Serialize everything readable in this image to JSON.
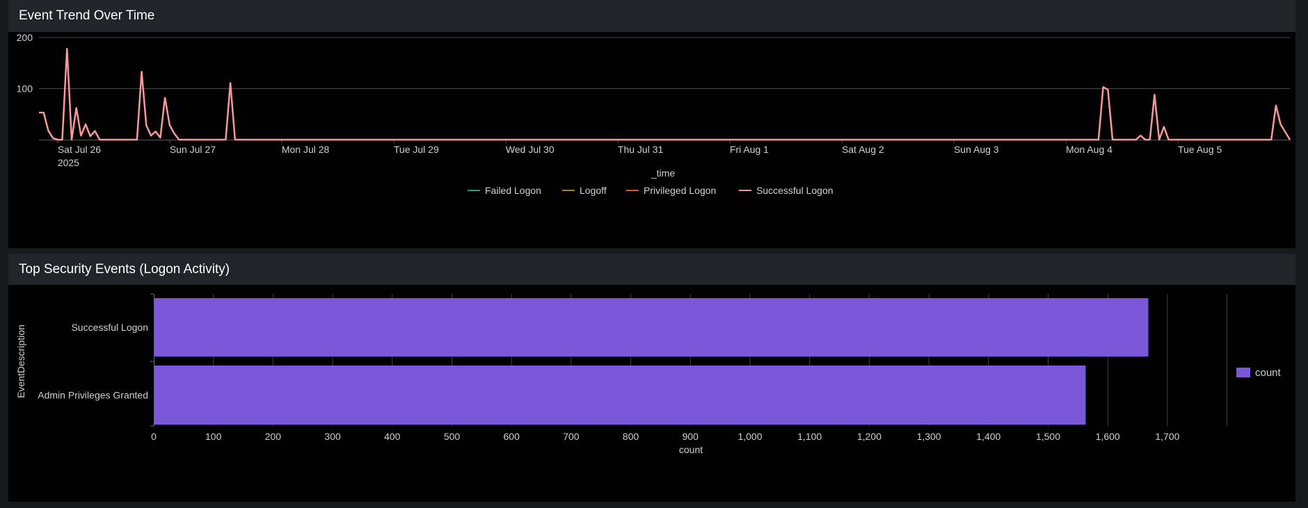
{
  "panels": [
    {
      "title": "Event Trend Over Time"
    },
    {
      "title": "Top Security Events (Logon Activity)"
    }
  ],
  "colors": {
    "panel_bg": "#000000",
    "header_bg": "#212529",
    "page_bg": "#171a1d",
    "failed_logon": "#1f9c93",
    "logoff": "#b87a1a",
    "privileged_logon": "#d8552a",
    "successful_logon": "#f79999",
    "bar": "#7b57d9"
  },
  "chart_data": [
    {
      "type": "line",
      "title": "Event Trend Over Time",
      "xlabel": "_time",
      "ylabel": "",
      "ylim": [
        0,
        200
      ],
      "y_ticks": [
        "100",
        "200"
      ],
      "x_ticks": [
        "Sat Jul 26",
        "Sun Jul 27",
        "Mon Jul 28",
        "Tue Jul 29",
        "Wed Jul 30",
        "Thu Jul 31",
        "Fri Aug 1",
        "Sat Aug 2",
        "Sun Aug 3",
        "Mon Aug 4",
        "Tue Aug 5"
      ],
      "x_tick_year": "2025",
      "grid": true,
      "legend": "bottom",
      "series": [
        {
          "name": "Failed Logon",
          "points": []
        },
        {
          "name": "Logoff",
          "points": []
        },
        {
          "name": "Privileged Logon",
          "points": []
        },
        {
          "name": "Successful Logon",
          "points": [
            [
              "2025-07-25 21:00",
              53
            ],
            [
              "2025-07-25 22:00",
              18
            ],
            [
              "2025-07-25 23:00",
              3
            ],
            [
              "2025-07-26 00:00",
              0
            ],
            [
              "2025-07-26 01:00",
              0
            ],
            [
              "2025-07-26 02:00",
              178
            ],
            [
              "2025-07-26 03:00",
              0
            ],
            [
              "2025-07-26 04:00",
              62
            ],
            [
              "2025-07-26 05:00",
              8
            ],
            [
              "2025-07-26 06:00",
              30
            ],
            [
              "2025-07-26 07:00",
              7
            ],
            [
              "2025-07-26 08:00",
              17
            ],
            [
              "2025-07-26 09:00",
              0
            ],
            [
              "2025-07-26 10:00",
              0
            ],
            [
              "2025-07-26 11:00",
              0
            ],
            [
              "2025-07-26 12:00",
              0
            ],
            [
              "2025-07-26 13:00",
              0
            ],
            [
              "2025-07-26 14:00",
              0
            ],
            [
              "2025-07-26 15:00",
              0
            ],
            [
              "2025-07-26 16:00",
              0
            ],
            [
              "2025-07-26 17:00",
              0
            ],
            [
              "2025-07-26 18:00",
              133
            ],
            [
              "2025-07-26 19:00",
              28
            ],
            [
              "2025-07-26 20:00",
              8
            ],
            [
              "2025-07-26 21:00",
              16
            ],
            [
              "2025-07-26 22:00",
              4
            ],
            [
              "2025-07-26 23:00",
              82
            ],
            [
              "2025-07-27 00:00",
              28
            ],
            [
              "2025-07-27 01:00",
              12
            ],
            [
              "2025-07-27 02:00",
              0
            ],
            [
              "2025-07-27 03:00",
              0
            ],
            [
              "2025-07-27 04:00",
              0
            ],
            [
              "2025-07-27 05:00",
              0
            ],
            [
              "2025-07-27 06:00",
              0
            ],
            [
              "2025-07-27 07:00",
              0
            ],
            [
              "2025-07-27 08:00",
              0
            ],
            [
              "2025-07-27 09:00",
              0
            ],
            [
              "2025-07-27 10:00",
              0
            ],
            [
              "2025-07-27 11:00",
              0
            ],
            [
              "2025-07-27 12:00",
              0
            ],
            [
              "2025-07-27 13:00",
              111
            ],
            [
              "2025-07-27 14:00",
              0
            ],
            [
              "2025-08-04 07:00",
              0
            ],
            [
              "2025-08-04 08:00",
              103
            ],
            [
              "2025-08-04 09:00",
              98
            ],
            [
              "2025-08-04 10:00",
              0
            ],
            [
              "2025-08-04 15:00",
              0
            ],
            [
              "2025-08-04 16:00",
              8
            ],
            [
              "2025-08-04 17:00",
              0
            ],
            [
              "2025-08-04 18:00",
              0
            ],
            [
              "2025-08-04 19:00",
              88
            ],
            [
              "2025-08-04 20:00",
              0
            ],
            [
              "2025-08-04 21:00",
              25
            ],
            [
              "2025-08-04 22:00",
              0
            ],
            [
              "2025-08-05 20:00",
              0
            ],
            [
              "2025-08-05 21:00",
              67
            ],
            [
              "2025-08-05 22:00",
              30
            ]
          ]
        }
      ]
    },
    {
      "type": "bar",
      "orientation": "horizontal",
      "title": "Top Security Events (Logon Activity)",
      "categories": [
        "Successful Logon",
        "Admin Privileges Granted"
      ],
      "series": [
        {
          "name": "count",
          "values": [
            1668,
            1563
          ]
        }
      ],
      "xlabel": "count",
      "ylabel": "EventDescription",
      "xlim": [
        0,
        1800
      ],
      "x_ticks": [
        "0",
        "100",
        "200",
        "300",
        "400",
        "500",
        "600",
        "700",
        "800",
        "900",
        "1,000",
        "1,100",
        "1,200",
        "1,300",
        "1,400",
        "1,500",
        "1,600",
        "1,700"
      ],
      "grid": true,
      "legend": "right"
    }
  ]
}
